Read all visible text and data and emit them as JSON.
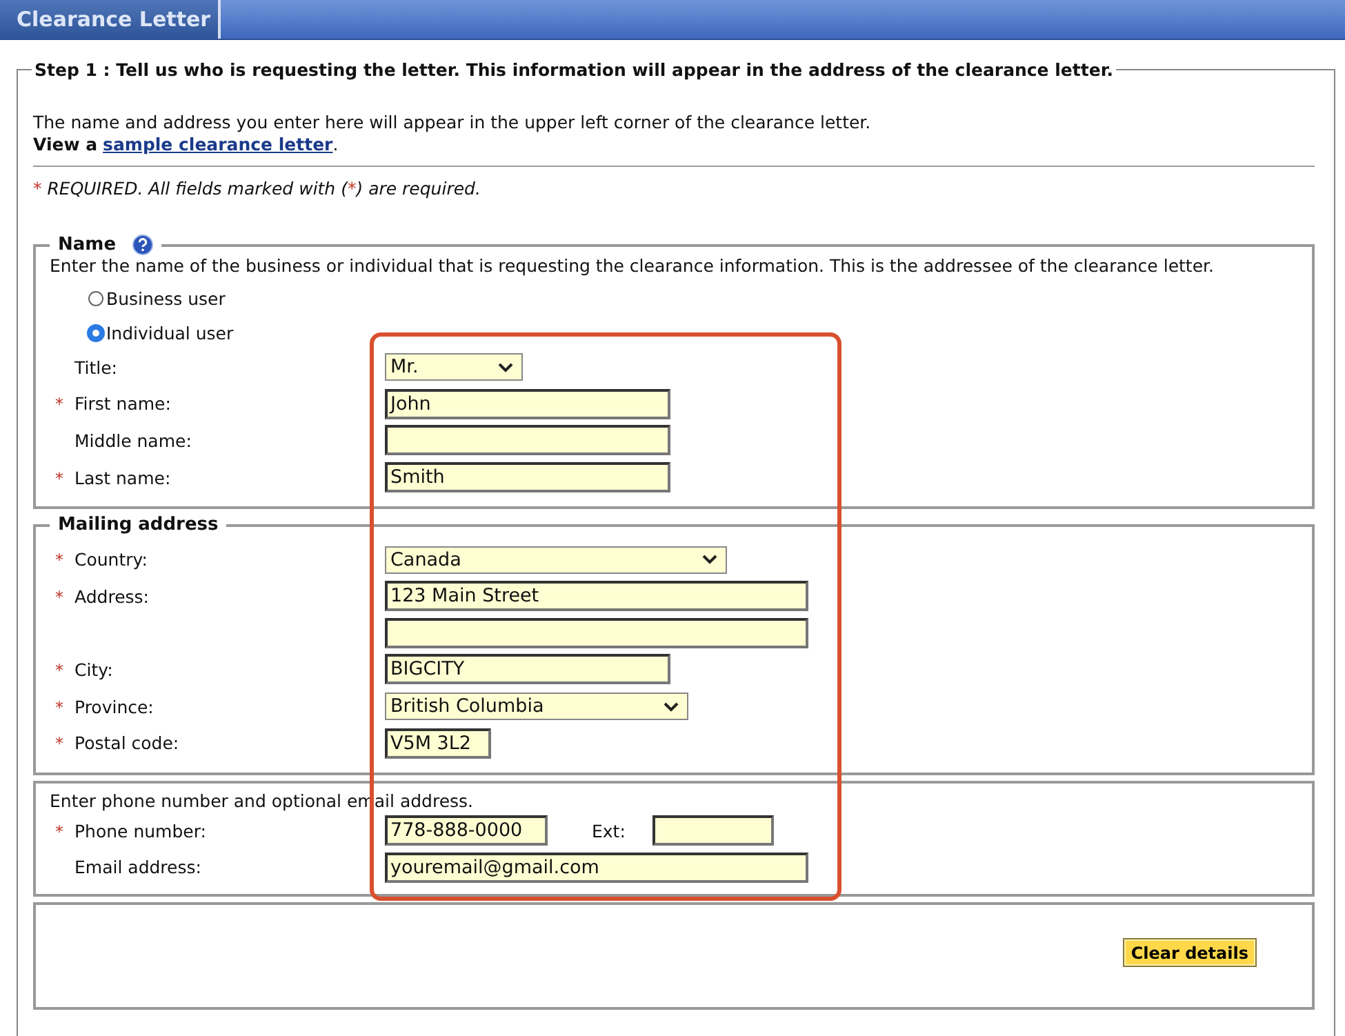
{
  "header": {
    "tab": "Clearance Letter"
  },
  "step": {
    "legend": "Step 1 : Tell us who is requesting the letter. This information will appear in the address of the clearance letter.",
    "intro": "The name and address you enter here will appear in the upper left corner of the clearance letter.",
    "sample_prefix": "View a",
    "sample_link": "sample clearance letter",
    "sample_suffix": ".",
    "required_note": {
      "mark": "*",
      "before": "REQUIRED. All fields marked with (",
      "inner_mark": "*",
      "after": ") are required."
    }
  },
  "name_section": {
    "legend": "Name",
    "description": "Enter the name of the business or individual that is requesting the clearance information. This is the addressee of the clearance letter.",
    "user_types": [
      {
        "label": "Business user",
        "selected": false
      },
      {
        "label": "Individual user",
        "selected": true
      }
    ],
    "fields": [
      {
        "kind": "select",
        "label": "Title:",
        "required": false,
        "value": "Mr."
      },
      {
        "kind": "text",
        "label": "First name:",
        "required": true,
        "value": "John"
      },
      {
        "kind": "text",
        "label": "Middle name:",
        "required": false
      },
      {
        "kind": "text",
        "label": "Last name:",
        "required": true,
        "value": "Smith"
      }
    ]
  },
  "address_section": {
    "legend": "Mailing address",
    "fields": [
      {
        "kind": "select",
        "label": "Country:",
        "required": true,
        "value": "Canada"
      },
      {
        "kind": "text",
        "label": "Address:",
        "required": true,
        "value": "123 Main Street"
      },
      {
        "kind": "text",
        "required": false
      },
      {
        "kind": "text",
        "label": "City:",
        "required": true,
        "value": "BIGCITY"
      },
      {
        "kind": "select",
        "label": "Province:",
        "required": true,
        "value": "British Columbia"
      },
      {
        "kind": "text",
        "label": "Postal code:",
        "required": true,
        "value": "V5M 3L2"
      }
    ]
  },
  "contact_section": {
    "description": "Enter phone number and optional email address.",
    "fields": [
      {
        "kind": "phone",
        "label": "Phone number:",
        "required": true,
        "value": "778-888-0000",
        "ext_label": "Ext:"
      },
      {
        "kind": "text",
        "label": "Email address:",
        "required": false,
        "value": "youremail@gmail.com"
      }
    ]
  },
  "buttons": [
    {
      "label": "Clear details"
    }
  ]
}
